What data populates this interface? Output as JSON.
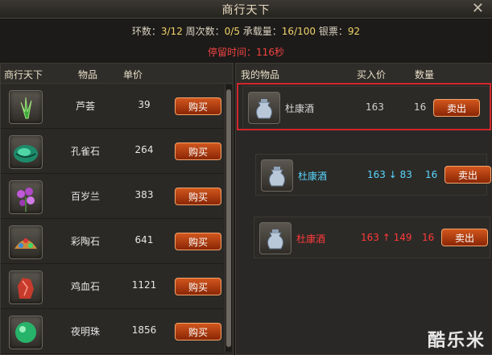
{
  "window": {
    "title": "商行天下",
    "close_icon": "close-icon"
  },
  "stats": {
    "label_round": "环数：",
    "round": "3/12",
    "label_week": " 周次数：",
    "week": "0/5",
    "label_load": " 承载量：",
    "load": "16/100",
    "label_silver": " 银票：",
    "silver": "92"
  },
  "stay_time": "停留时间：116秒",
  "left": {
    "headers": {
      "market": "商行天下",
      "item": "物品",
      "price": "单价"
    },
    "buy_label": "购买",
    "items": [
      {
        "name": "芦荟",
        "price": "39",
        "icon": "aloe-icon",
        "color": "#3ca83c"
      },
      {
        "name": "孔雀石",
        "price": "264",
        "icon": "malachite-icon",
        "color": "#1e8a6a"
      },
      {
        "name": "百岁兰",
        "price": "383",
        "icon": "orchid-icon",
        "color": "#b04ac8"
      },
      {
        "name": "彩陶石",
        "price": "641",
        "icon": "painted-stone-icon",
        "color": "#c98a3c"
      },
      {
        "name": "鸡血石",
        "price": "1121",
        "icon": "bloodstone-icon",
        "color": "#c63b2c"
      },
      {
        "name": "夜明珠",
        "price": "1856",
        "icon": "luminous-pearl-icon",
        "color": "#28b36a"
      }
    ]
  },
  "right": {
    "headers": {
      "my_items": "我的物品",
      "buy_price": "买入价",
      "qty": "数量"
    },
    "sell_label": "卖出",
    "items": [
      {
        "name": "杜康酒",
        "buy": "163",
        "qty": "16",
        "name_color": "#d8d8d8",
        "buy_color": "#cfcfcf",
        "qty_color": "#cfcfcf"
      },
      {
        "name": "杜康酒",
        "buy": "163 ↓ 83",
        "qty": "16",
        "name_color": "#58d7ff",
        "buy_color": "#58d7ff",
        "qty_color": "#58d7ff"
      },
      {
        "name": "杜康酒",
        "buy": "163 ↑ 149",
        "qty": "16",
        "name_color": "#ff3a3a",
        "buy_color": "#ff3a3a",
        "qty_color": "#ff3a3a"
      }
    ]
  },
  "watermark": "酷乐米"
}
